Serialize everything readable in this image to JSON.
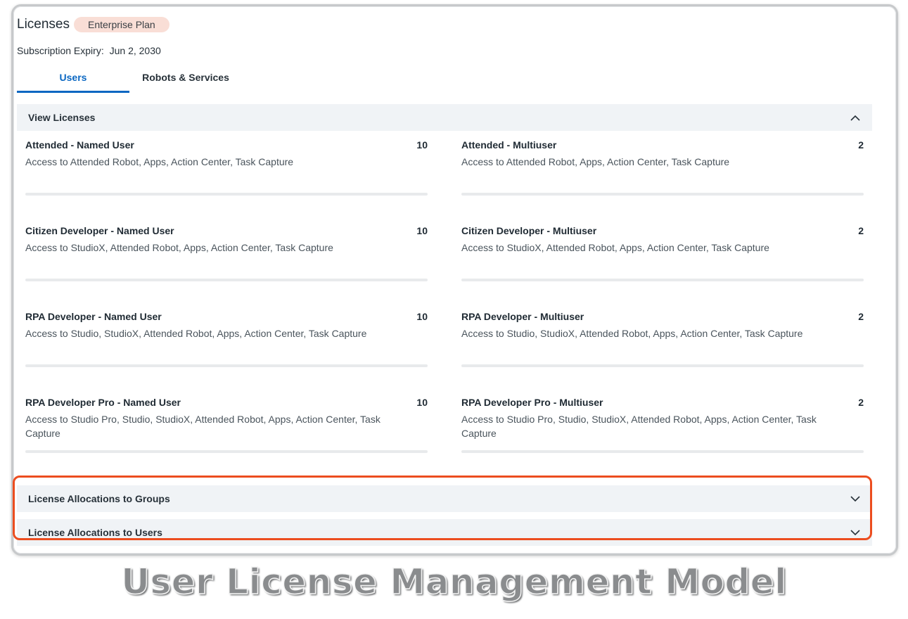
{
  "header": {
    "title": "Licenses",
    "plan_badge": "Enterprise Plan",
    "expiry_label": "Subscription Expiry:",
    "expiry_value": "Jun 2, 2030"
  },
  "tabs": [
    {
      "label": "Users",
      "active": true
    },
    {
      "label": "Robots & Services",
      "active": false
    }
  ],
  "view_licenses": {
    "title": "View Licenses",
    "expanded": true,
    "licenses": [
      {
        "name": "Attended - Named User",
        "count": "10",
        "description": "Access to Attended Robot, Apps, Action Center, Task Capture"
      },
      {
        "name": "Attended - Multiuser",
        "count": "2",
        "description": "Access to Attended Robot, Apps, Action Center, Task Capture"
      },
      {
        "name": "Citizen Developer - Named User",
        "count": "10",
        "description": "Access to StudioX, Attended Robot, Apps, Action Center, Task Capture"
      },
      {
        "name": "Citizen Developer - Multiuser",
        "count": "2",
        "description": "Access to StudioX, Attended Robot, Apps, Action Center, Task Capture"
      },
      {
        "name": "RPA Developer - Named User",
        "count": "10",
        "description": "Access to Studio, StudioX, Attended Robot, Apps, Action Center, Task Capture"
      },
      {
        "name": "RPA Developer - Multiuser",
        "count": "2",
        "description": "Access to Studio, StudioX, Attended Robot, Apps, Action Center, Task Capture"
      },
      {
        "name": "RPA Developer Pro - Named User",
        "count": "10",
        "description": "Access to Studio Pro, Studio, StudioX, Attended Robot, Apps, Action Center, Task Capture"
      },
      {
        "name": "RPA Developer Pro - Multiuser",
        "count": "2",
        "description": "Access to Studio Pro, Studio, StudioX, Attended Robot, Apps, Action Center, Task Capture"
      }
    ]
  },
  "allocations": {
    "groups_title": "License Allocations to Groups",
    "users_title": "License Allocations to Users"
  },
  "caption": "User License Management Model",
  "colors": {
    "accent": "#0a67c2",
    "badge_bg": "#f9ded6",
    "highlight": "#ec4d1f",
    "section_bg": "#f0f3f6"
  },
  "icons": {
    "collapse": "chevron-up-icon",
    "expand": "chevron-down-icon"
  }
}
